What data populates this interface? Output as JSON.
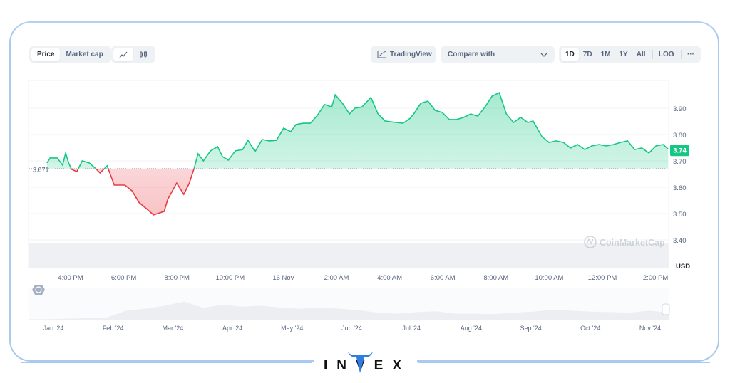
{
  "toolbar": {
    "view_tabs": [
      {
        "label": "Price",
        "active": true
      },
      {
        "label": "Market cap",
        "active": false
      }
    ],
    "chart_type_icons": [
      {
        "icon": "line-chart-icon",
        "active": true
      },
      {
        "icon": "candlestick-icon",
        "active": false
      }
    ],
    "tradingview_label": "TradingView",
    "compare_label": "Compare with",
    "ranges": [
      {
        "label": "1D",
        "active": true
      },
      {
        "label": "7D"
      },
      {
        "label": "1M"
      },
      {
        "label": "1Y"
      },
      {
        "label": "All"
      }
    ],
    "log_label": "LOG",
    "more_label": "···"
  },
  "watermark": "CoinMarketCap",
  "brand": "INVEX",
  "colors": {
    "up": "#16c784",
    "down": "#ea3943",
    "current_badge": "#16c784",
    "frame": "#a9c9ef",
    "brand_blue": "#2f7de1"
  },
  "chart_data": {
    "type": "area",
    "currency_label": "USD",
    "baseline": 3.671,
    "baseline_label": "3.671",
    "current_price": 3.74,
    "current_price_label": "3.74",
    "ylim": [
      3.37,
      3.98
    ],
    "y_ticks": [
      "3.90",
      "3.80",
      "3.70",
      "3.60",
      "3.50",
      "3.40"
    ],
    "x_ticks": [
      "4:00 PM",
      "6:00 PM",
      "8:00 PM",
      "10:00 PM",
      "16 Nov",
      "2:00 AM",
      "4:00 AM",
      "6:00 AM",
      "8:00 AM",
      "10:00 AM",
      "12:00 PM",
      "2:00 PM"
    ],
    "grid": true,
    "navigator_ticks": [
      "Jan '24",
      "Feb '24",
      "Mar '24",
      "Apr '24",
      "May '24",
      "Jun '24",
      "Jul '24",
      "Aug '24",
      "Sep '24",
      "Oct '24",
      "Nov '24"
    ],
    "points": [
      [
        "15:07",
        3.692
      ],
      [
        "15:14",
        3.711
      ],
      [
        "15:30",
        3.711
      ],
      [
        "15:42",
        3.684
      ],
      [
        "15:49",
        3.73
      ],
      [
        "15:55",
        3.695
      ],
      [
        "16:02",
        3.668
      ],
      [
        "16:14",
        3.659
      ],
      [
        "16:26",
        3.7
      ],
      [
        "16:42",
        3.692
      ],
      [
        "16:58",
        3.668
      ],
      [
        "17:06",
        3.654
      ],
      [
        "17:22",
        3.681
      ],
      [
        "17:38",
        3.608
      ],
      [
        "18:02",
        3.608
      ],
      [
        "18:18",
        3.586
      ],
      [
        "18:34",
        3.541
      ],
      [
        "18:50",
        3.519
      ],
      [
        "19:06",
        3.495
      ],
      [
        "19:30",
        3.508
      ],
      [
        "19:38",
        3.554
      ],
      [
        "19:58",
        3.616
      ],
      [
        "20:14",
        3.573
      ],
      [
        "20:26",
        3.614
      ],
      [
        "20:37",
        3.67
      ],
      [
        "20:46",
        3.727
      ],
      [
        "20:58",
        3.7
      ],
      [
        "21:14",
        3.738
      ],
      [
        "21:30",
        3.754
      ],
      [
        "21:41",
        3.716
      ],
      [
        "21:54",
        3.703
      ],
      [
        "22:10",
        3.738
      ],
      [
        "22:26",
        3.743
      ],
      [
        "22:38",
        3.778
      ],
      [
        "22:54",
        3.735
      ],
      [
        "23:10",
        3.781
      ],
      [
        "23:26",
        3.776
      ],
      [
        "23:42",
        3.778
      ],
      [
        "23:58",
        3.824
      ],
      [
        "00:14",
        3.811
      ],
      [
        "00:26",
        3.838
      ],
      [
        "00:42",
        3.843
      ],
      [
        "00:58",
        3.843
      ],
      [
        "01:14",
        3.873
      ],
      [
        "01:30",
        3.914
      ],
      [
        "01:46",
        3.905
      ],
      [
        "01:54",
        3.951
      ],
      [
        "02:10",
        3.919
      ],
      [
        "02:26",
        3.878
      ],
      [
        "02:38",
        3.9
      ],
      [
        "02:54",
        3.905
      ],
      [
        "03:14",
        3.941
      ],
      [
        "03:30",
        3.878
      ],
      [
        "03:46",
        3.851
      ],
      [
        "04:10",
        3.846
      ],
      [
        "04:26",
        3.843
      ],
      [
        "04:42",
        3.862
      ],
      [
        "04:50",
        3.878
      ],
      [
        "05:06",
        3.919
      ],
      [
        "05:22",
        3.927
      ],
      [
        "05:38",
        3.892
      ],
      [
        "05:54",
        3.884
      ],
      [
        "06:10",
        3.857
      ],
      [
        "06:26",
        3.857
      ],
      [
        "06:42",
        3.865
      ],
      [
        "06:58",
        3.878
      ],
      [
        "07:14",
        3.87
      ],
      [
        "07:30",
        3.905
      ],
      [
        "07:46",
        3.946
      ],
      [
        "08:02",
        3.959
      ],
      [
        "08:18",
        3.878
      ],
      [
        "08:34",
        3.846
      ],
      [
        "08:50",
        3.865
      ],
      [
        "09:06",
        3.846
      ],
      [
        "09:18",
        3.851
      ],
      [
        "09:38",
        3.792
      ],
      [
        "09:54",
        3.77
      ],
      [
        "10:10",
        3.776
      ],
      [
        "10:26",
        3.77
      ],
      [
        "10:42",
        3.749
      ],
      [
        "10:58",
        3.762
      ],
      [
        "11:14",
        3.743
      ],
      [
        "11:30",
        3.757
      ],
      [
        "11:46",
        3.762
      ],
      [
        "12:02",
        3.757
      ],
      [
        "12:18",
        3.762
      ],
      [
        "12:34",
        3.77
      ],
      [
        "12:50",
        3.776
      ],
      [
        "13:06",
        3.743
      ],
      [
        "13:22",
        3.749
      ],
      [
        "13:38",
        3.73
      ],
      [
        "13:54",
        3.757
      ],
      [
        "14:10",
        3.762
      ],
      [
        "14:21",
        3.745
      ]
    ]
  }
}
